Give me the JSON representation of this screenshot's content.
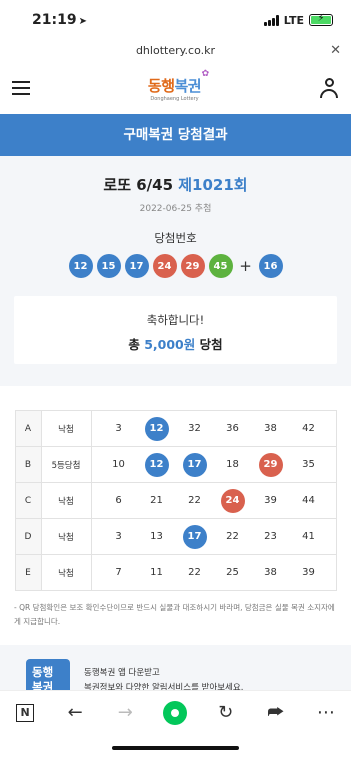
{
  "status": {
    "time": "21:19",
    "network": "LTE"
  },
  "url": "dhlottery.co.kr",
  "logo": {
    "text_part1": "동행",
    "text_part2": "복권",
    "sub": "Donghaeng Lottery"
  },
  "banner_title": "구매복권 당첨결과",
  "round": {
    "game": "로또 6/45",
    "number": "제1021회",
    "date": "2022-06-25 추첨"
  },
  "winning": {
    "label": "당첨번호",
    "numbers": [
      {
        "n": "12",
        "color": "#3d80c9"
      },
      {
        "n": "15",
        "color": "#3d80c9"
      },
      {
        "n": "17",
        "color": "#3d80c9"
      },
      {
        "n": "24",
        "color": "#d9614e"
      },
      {
        "n": "29",
        "color": "#d9614e"
      },
      {
        "n": "45",
        "color": "#5db23f"
      }
    ],
    "plus": "+",
    "bonus": {
      "n": "16",
      "color": "#3d80c9"
    }
  },
  "result": {
    "congrats": "축하합니다!",
    "prefix": "총 ",
    "amount": "5,000원",
    "suffix": " 당첨"
  },
  "ticket": [
    {
      "line": "A",
      "result": "낙첨",
      "nums": [
        {
          "n": "3"
        },
        {
          "n": "12",
          "color": "#3d80c9"
        },
        {
          "n": "32"
        },
        {
          "n": "36"
        },
        {
          "n": "38"
        },
        {
          "n": "42"
        }
      ]
    },
    {
      "line": "B",
      "result": "5등당첨",
      "nums": [
        {
          "n": "10"
        },
        {
          "n": "12",
          "color": "#3d80c9"
        },
        {
          "n": "17",
          "color": "#3d80c9"
        },
        {
          "n": "18"
        },
        {
          "n": "29",
          "color": "#d9614e"
        },
        {
          "n": "35"
        }
      ]
    },
    {
      "line": "C",
      "result": "낙첨",
      "nums": [
        {
          "n": "6"
        },
        {
          "n": "21"
        },
        {
          "n": "22"
        },
        {
          "n": "24",
          "color": "#d9614e"
        },
        {
          "n": "39"
        },
        {
          "n": "44"
        }
      ]
    },
    {
      "line": "D",
      "result": "낙첨",
      "nums": [
        {
          "n": "3"
        },
        {
          "n": "13"
        },
        {
          "n": "17",
          "color": "#3d80c9"
        },
        {
          "n": "22"
        },
        {
          "n": "23"
        },
        {
          "n": "41"
        }
      ]
    },
    {
      "line": "E",
      "result": "낙첨",
      "nums": [
        {
          "n": "7"
        },
        {
          "n": "11"
        },
        {
          "n": "22"
        },
        {
          "n": "25"
        },
        {
          "n": "38"
        },
        {
          "n": "39"
        }
      ]
    }
  ],
  "notice": "- QR 당첨확인은 보조 확인수단이므로 반드시 실물과 대조하시기 바라며, 당첨금은 실물 복권 소지자에게 지급합니다.",
  "app": {
    "logo_line1": "동행",
    "logo_line2": "복권",
    "line1": "동행복권 앱 다운받고",
    "line2": "복권정보와 다양한 알림서비스를 받아보세요."
  },
  "toolbar": {
    "n_label": "N",
    "back_icon": "←",
    "forward_icon": "→",
    "refresh_icon": "↻",
    "share_icon": "⮫",
    "more_icon": "⋯"
  }
}
